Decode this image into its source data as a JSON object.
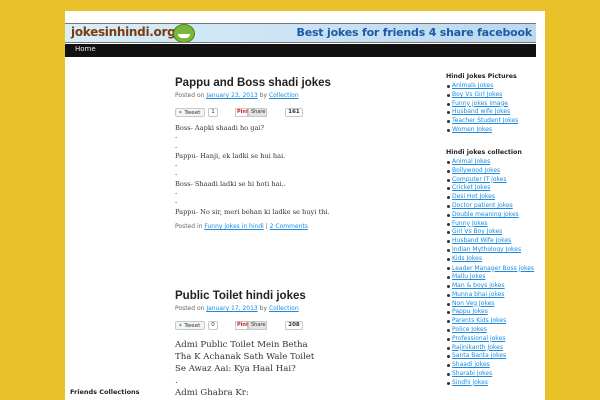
{
  "header": {
    "logo_text": "jokesinhindi.org",
    "tagline": "Best jokes for friends 4 share facebook",
    "nav_home": "Home"
  },
  "posts": [
    {
      "title": "Pappu and Boss shadi jokes",
      "posted_on_label": "Posted on",
      "date": "January 23, 2013",
      "by_label": "by",
      "author": "Collection",
      "tweet_label": "Tweet",
      "tweet_count": "1",
      "pin_label": "Pinit",
      "share_label": "Share",
      "share_count": "161",
      "lines": [
        "Boss- Aapki shaadi ho gai?",
        "-",
        "-",
        "Pappu- Hanji, ek ladki se hui hai.",
        "-",
        "-",
        "Boss- Shaadi ladki se hi hoti hai..",
        "-",
        "-",
        "Pappu- No sir, meri behan ki ladke se huyi thi."
      ],
      "posted_in_label": "Posted in",
      "category": "Funny jokes in hindi",
      "separator": "|",
      "comments": "2 Comments"
    },
    {
      "title": "Public Toilet hindi jokes",
      "posted_on_label": "Posted on",
      "date": "January 17, 2013",
      "by_label": "by",
      "author": "Collection",
      "tweet_label": "Tweet",
      "tweet_count": "0",
      "pin_label": "Pinit",
      "share_label": "Share",
      "share_count": "208",
      "lines": [
        "Admi Public Toilet Mein Betha",
        "Tha K Achanak Sath Wale Toilet",
        "Se Awaz Aai: Kya Haal Hai?",
        ".",
        "Admi Ghabra Kr:"
      ]
    }
  ],
  "sidebar": {
    "pictures_title": "Hindi Jokes Pictures",
    "pictures": [
      "Animals Jokes",
      "Boy Vs Girl Jokes",
      "Funny jokes image",
      "Husband wife Jokes",
      "Teacher Student Jokes",
      "Women Jokes"
    ],
    "collection_title": "Hindi jokes collection",
    "collection": [
      "Animal Jokes",
      "Bollywood Jokes",
      "Computer IT jokes",
      "Cricket Jokes",
      "Desi Hot Jokes",
      "Doctor patient Jokes",
      "Double meaning jokes",
      "Funny Jokes",
      "Girl Vs Boy Jokes",
      "Husband Wife Jokes",
      "Indian Mythology Jokes",
      "Kids Jokes",
      "Leader Manager Boss jokes",
      "Mallu Jokes",
      "Man & boys jokes",
      "Munna bhai jokes",
      "Non Veg Jokes",
      "Pappu Jokes",
      "Parents Kids Jokes",
      "Police Jokes",
      "Professional jokes",
      "Rajinikanth Jokes",
      "Santa Banta jokes",
      "Shaadi jokes",
      "Sharabi jokes",
      "Sindhi jokes"
    ]
  },
  "left_widget": {
    "title": "Friends Collections"
  }
}
